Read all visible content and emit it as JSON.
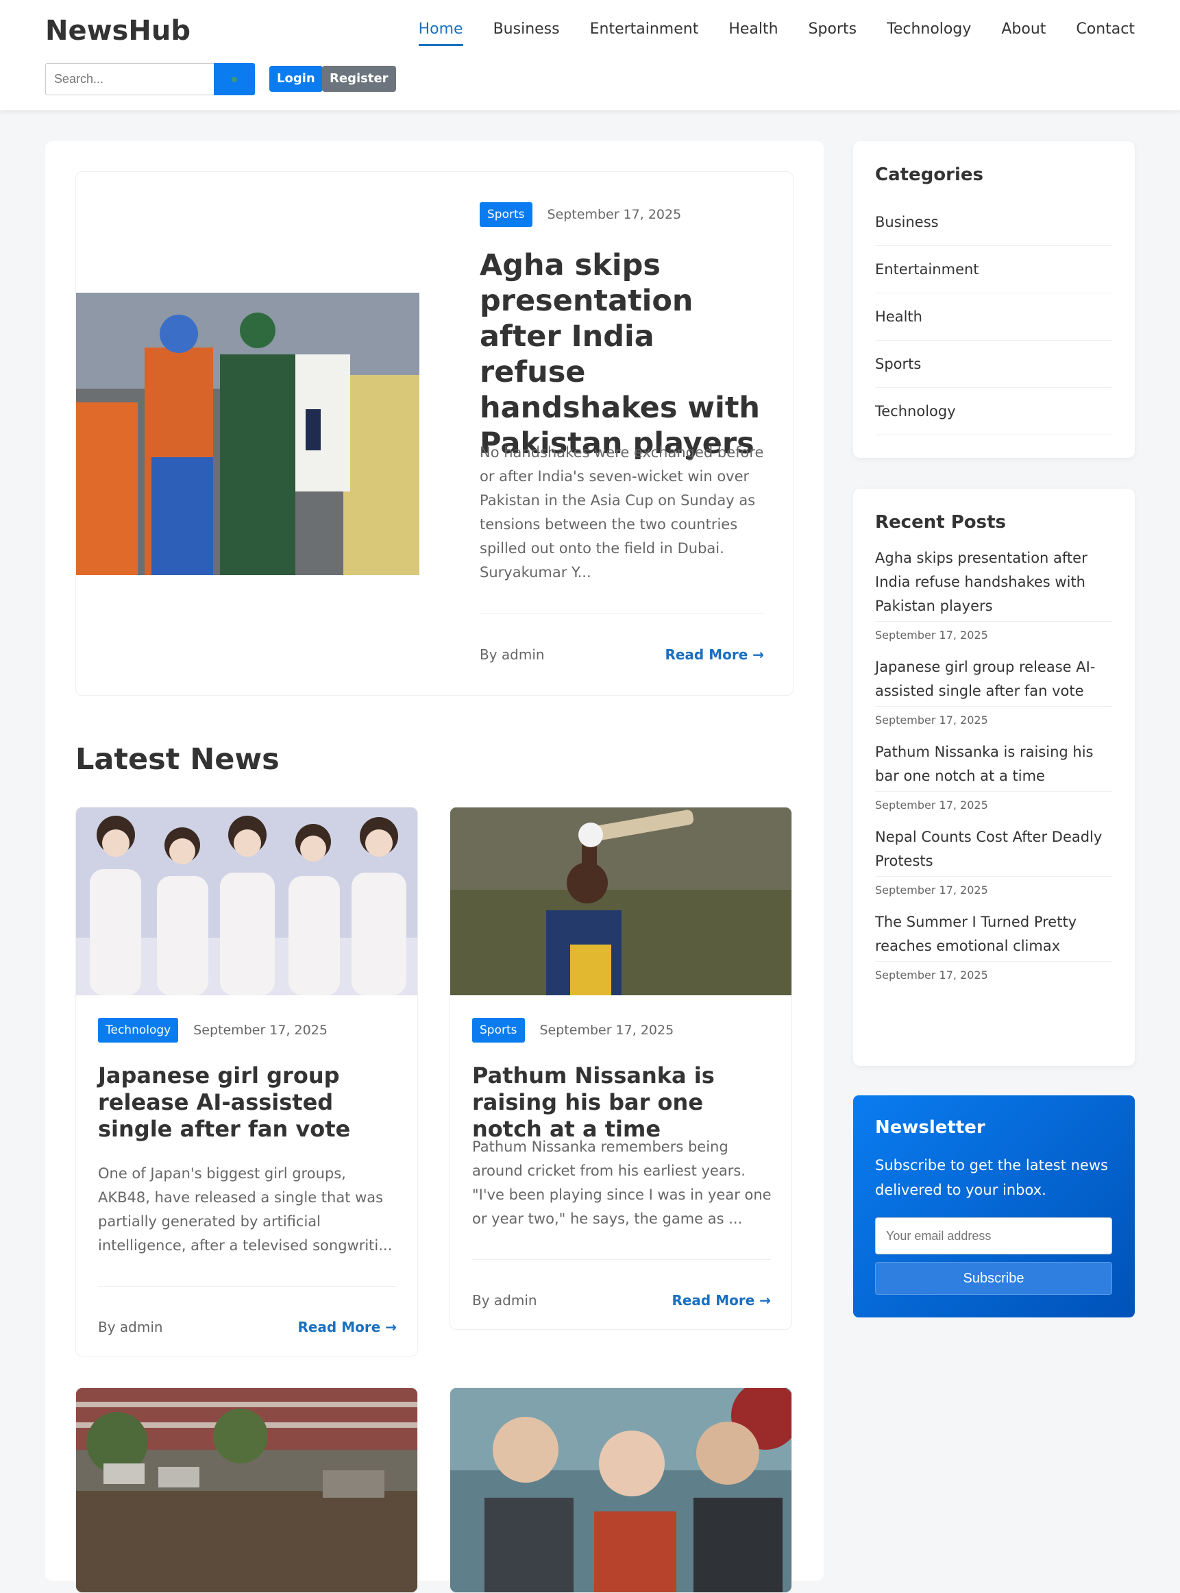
{
  "site": {
    "logo": "NewsHub"
  },
  "nav": [
    {
      "label": "Home",
      "active": true
    },
    {
      "label": "Business"
    },
    {
      "label": "Entertainment"
    },
    {
      "label": "Health"
    },
    {
      "label": "Sports"
    },
    {
      "label": "Technology"
    },
    {
      "label": "About"
    },
    {
      "label": "Contact"
    }
  ],
  "search": {
    "placeholder": "Search..."
  },
  "auth": {
    "login": "Login",
    "register": "Register"
  },
  "featured": {
    "category": "Sports",
    "date": "September 17, 2025",
    "title": "Agha skips presentation after India refuse handshakes with Pakistan players",
    "excerpt": "No handshakes were exchanged before or after India's seven-wicket win over Pakistan in the Asia Cup on Sunday as tensions between the two countries spilled out onto the field in Dubai. Suryakumar Y...",
    "author": "By admin",
    "read_more": "Read More →"
  },
  "latest": {
    "title": "Latest News",
    "cards": [
      {
        "category": "Technology",
        "date": "September 17, 2025",
        "title": "Japanese girl group release AI-assisted single after fan vote",
        "excerpt": "One of Japan's biggest girl groups, AKB48, have released a single that was partially generated by artificial intelligence, after a televised songwriti...",
        "author": "By admin",
        "read_more": "Read More →"
      },
      {
        "category": "Sports",
        "date": "September 17, 2025",
        "title": "Pathum Nissanka is raising his bar one notch at a time",
        "excerpt": "Pathum Nissanka remembers being around cricket from his earliest years. \"I've been playing since I was in year one or year two,\" he says, the game as ...",
        "author": "By admin",
        "read_more": "Read More →"
      }
    ]
  },
  "sidebar": {
    "categories_title": "Categories",
    "categories": [
      "Business",
      "Entertainment",
      "Health",
      "Sports",
      "Technology"
    ],
    "recent_title": "Recent Posts",
    "recent": [
      {
        "title": "Agha skips presentation after India refuse handshakes with Pakistan players",
        "date": "September 17, 2025"
      },
      {
        "title": "Japanese girl group release AI-assisted single after fan vote",
        "date": "September 17, 2025"
      },
      {
        "title": "Pathum Nissanka is raising his bar one notch at a time",
        "date": "September 17, 2025"
      },
      {
        "title": "Nepal Counts Cost After Deadly Protests",
        "date": "September 17, 2025"
      },
      {
        "title": "The Summer I Turned Pretty reaches emotional climax",
        "date": "September 17, 2025"
      }
    ],
    "newsletter": {
      "title": "Newsletter",
      "text": "Subscribe to get the latest news delivered to your inbox.",
      "placeholder": "Your email address",
      "button": "Subscribe"
    }
  },
  "colors": {
    "accent": "#0a7cf0",
    "link": "#1a6fc0",
    "secondary": "#6c757d"
  }
}
